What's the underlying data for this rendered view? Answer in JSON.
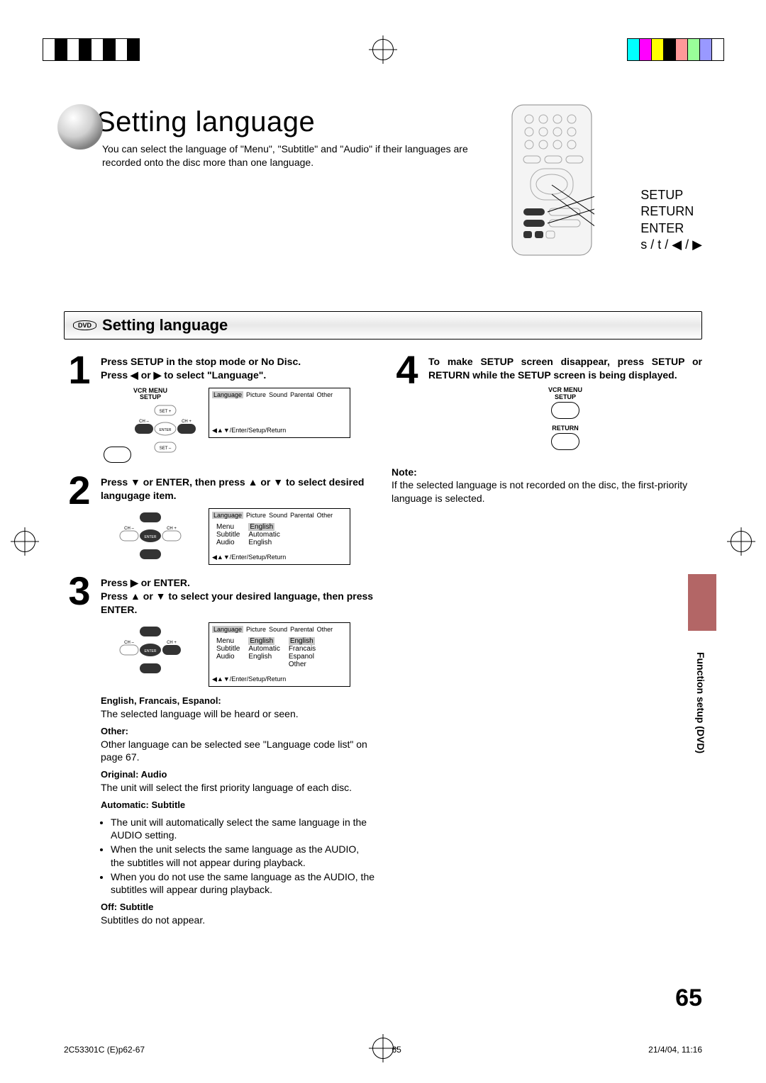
{
  "page": {
    "title": "Setting language",
    "intro": "You can select the language of \"Menu\", \"Subtitle\" and \"Audio\" if their languages are recorded onto the disc more than one language.",
    "section_header": "Setting language",
    "dvd_badge": "DVD",
    "page_number": "65",
    "side_category": "Function setup (DVD)"
  },
  "remote_labels": {
    "l1": "SETUP",
    "l2": "RETURN",
    "l3": "ENTER",
    "l4": "s / t / ◀ / ▶"
  },
  "steps": {
    "s1": {
      "num": "1",
      "line1": "Press SETUP in the stop mode or No Disc.",
      "line2_a": "Press ",
      "line2_b": " or ",
      "line2_c": " to select \"Language\".",
      "remote_label1": "VCR MENU",
      "remote_label2": "SETUP"
    },
    "s2": {
      "num": "2",
      "line1": "Press ▼ or ENTER, then press ▲ or ▼ to select desired langugage item."
    },
    "s3": {
      "num": "3",
      "line1": "Press ▶ or ENTER.",
      "line2": "Press ▲ or ▼ to select your desired language, then press ENTER."
    },
    "s4": {
      "num": "4",
      "text": "To make SETUP screen disappear, press SETUP or RETURN while the SETUP screen is being displayed.",
      "remote_label1": "VCR MENU",
      "remote_label2": "SETUP",
      "remote_label3": "RETURN"
    }
  },
  "osd": {
    "tabs": [
      "Language",
      "Picture",
      "Sound",
      "Parental",
      "Other"
    ],
    "footer1": "◀▲▼/Enter/Setup/Return",
    "footer2": "◀▲▼/Enter/Setup/Return",
    "footer3": "◀▲▼/Enter/Setup/Return",
    "step2_rows": [
      [
        "Menu",
        "English"
      ],
      [
        "Subtitle",
        "Automatic"
      ],
      [
        "Audio",
        "English"
      ]
    ],
    "step3_rows": [
      [
        "Menu",
        "English",
        "English"
      ],
      [
        "Subtitle",
        "Automatic",
        "Francais"
      ],
      [
        "Audio",
        "English",
        "Espanol"
      ],
      [
        "",
        "",
        "Other"
      ]
    ]
  },
  "notes": {
    "efs_h": "English, Francais, Espanol:",
    "efs_t": "The selected language will be heard or seen.",
    "other_h": "Other:",
    "other_t": "Other language can be selected see \"Language code list\" on page 67.",
    "orig_h": "Original: Audio",
    "orig_t": "The unit will select the first priority language of each disc.",
    "auto_h": "Automatic: Subtitle",
    "auto_b1": "The unit will automatically select the same language in the AUDIO setting.",
    "auto_b2": "When the unit selects the same language as the AUDIO, the subtitles will not appear during playback.",
    "auto_b3": "When you do not use the same language as the AUDIO, the subtitles will appear during playback.",
    "off_h": "Off: Subtitle",
    "off_t": "Subtitles do not appear."
  },
  "right_note": {
    "h": "Note:",
    "t": "If the selected language is not recorded on the disc, the first-priority language is selected."
  },
  "footer": {
    "left": "2C53301C (E)p62-67",
    "mid": "65",
    "right": "21/4/04, 11:16"
  },
  "dpad_labels": {
    "set_plus": "SET +",
    "set_minus": "SET –",
    "ch_minus": "CH –",
    "ch_plus": "CH +",
    "enter": "ENTER"
  }
}
